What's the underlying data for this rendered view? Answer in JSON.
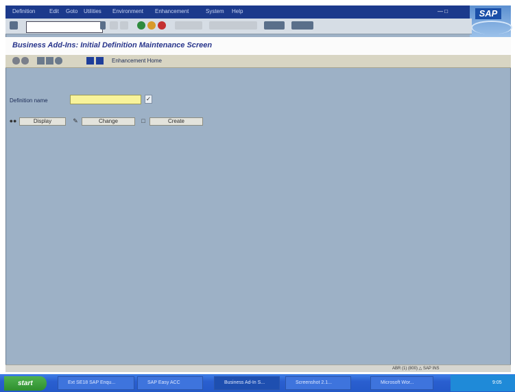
{
  "menu": {
    "items": [
      "Definition",
      "Edit",
      "Goto",
      "Utilities",
      "Environment",
      "Enhancement",
      "System",
      "Help"
    ]
  },
  "brand": {
    "logo": "SAP"
  },
  "title": {
    "text": "Business Add-Ins: Initial Definition Maintenance Screen"
  },
  "app_toolbar": {
    "enhancement_label": "Enhancement Home"
  },
  "form": {
    "definition_label": "Definition name",
    "definition_value": "",
    "f4_symbol": "✓"
  },
  "buttons": {
    "display_label": "Display",
    "change_label": "Change",
    "create_label": "Create"
  },
  "status": {
    "system_info": "ABR (1) (800)  △  SAP  INS"
  },
  "taskbar": {
    "start_label": "start",
    "tasks": [
      "Ext SE18 SAP Enqu...",
      "SAP Easy ACC",
      "Business Ad-In S...",
      "Screenshot 2.1...",
      "Microsoft Wor..."
    ],
    "clock": "9:05"
  },
  "colors": {
    "menubar": "#1c3a8c",
    "work_area": "#9db1c6",
    "title_text": "#27348b",
    "input_bg": "#f8f39a",
    "taskbar": "#2459c8",
    "start_button": "#2f8f2f"
  }
}
